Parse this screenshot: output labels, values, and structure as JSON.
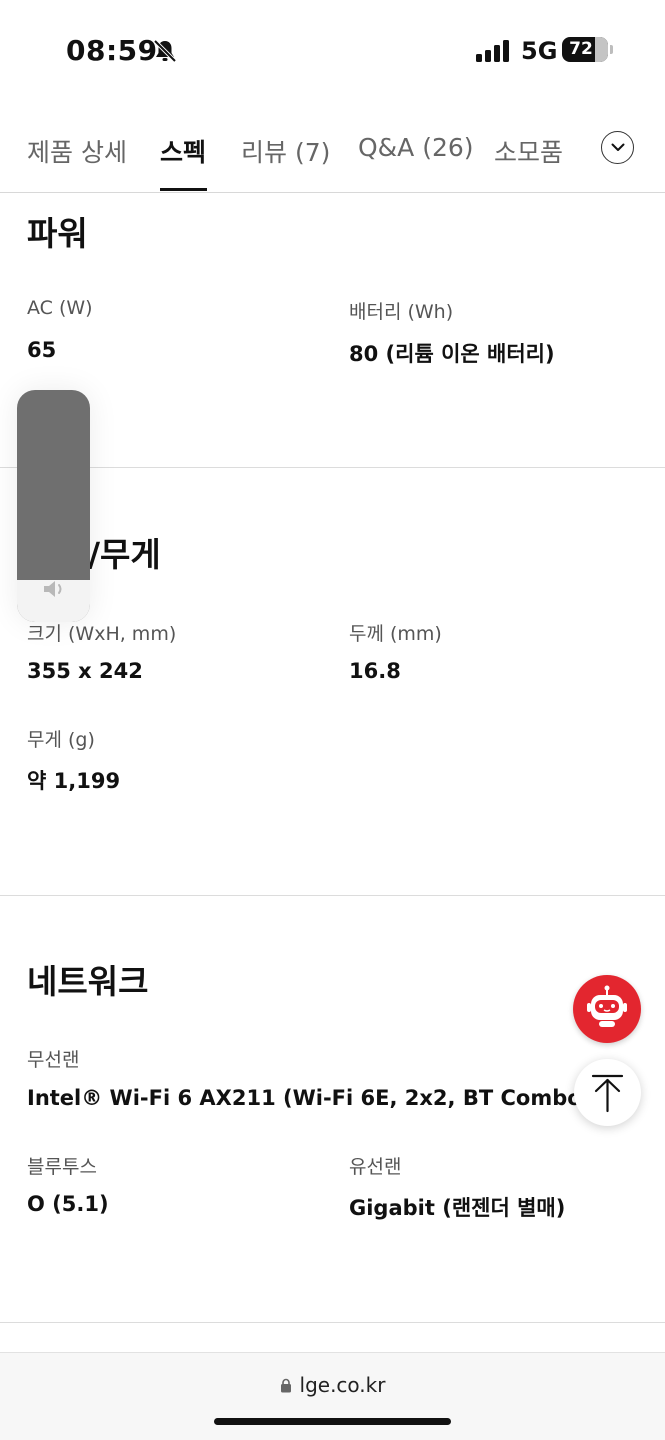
{
  "status_bar": {
    "time": "08:59",
    "network": "5G",
    "battery_level": 72,
    "battery_text": "72"
  },
  "tabs": [
    {
      "label": "제품 상세",
      "active": false
    },
    {
      "label": "스펙",
      "active": true
    },
    {
      "label": "리뷰 (7)",
      "active": false
    },
    {
      "label": "Q&A (26)",
      "active": false
    },
    {
      "label": "소모품",
      "active": false
    }
  ],
  "sections": {
    "power": {
      "title": "파워",
      "specs": [
        {
          "label": "AC (W)",
          "value": "65"
        },
        {
          "label": "배터리 (Wh)",
          "value": "80 (리튬 이온 배터리)"
        }
      ]
    },
    "size_weight": {
      "title": "/무게",
      "specs": [
        {
          "label": "크기 (WxH, mm)",
          "value": "355 x 242"
        },
        {
          "label": "두께 (mm)",
          "value": "16.8"
        },
        {
          "label": "무게 (g)",
          "value": "약 1,199"
        }
      ]
    },
    "network": {
      "title": "네트워크",
      "specs": [
        {
          "label": "무선랜",
          "value": "Intel® Wi-Fi 6 AX211 (Wi-Fi 6E, 2x2, BT Combo)"
        },
        {
          "label": "블루투스",
          "value": "O (5.1)"
        },
        {
          "label": "유선랜",
          "value": "Gigabit (랜젠더 별매)"
        }
      ]
    }
  },
  "volume_overlay": {
    "level": 0.18
  },
  "address_bar": {
    "url": "lge.co.kr"
  },
  "colors": {
    "chatbot": "#e3262f",
    "text": "#111111",
    "label": "#555555",
    "divider": "#dcdcdc"
  },
  "icons": [
    "bell-slash-icon",
    "signal-icon",
    "chevron-down-icon",
    "speaker-icon",
    "chatbot-robot-icon",
    "arrow-up-icon",
    "lock-icon"
  ]
}
